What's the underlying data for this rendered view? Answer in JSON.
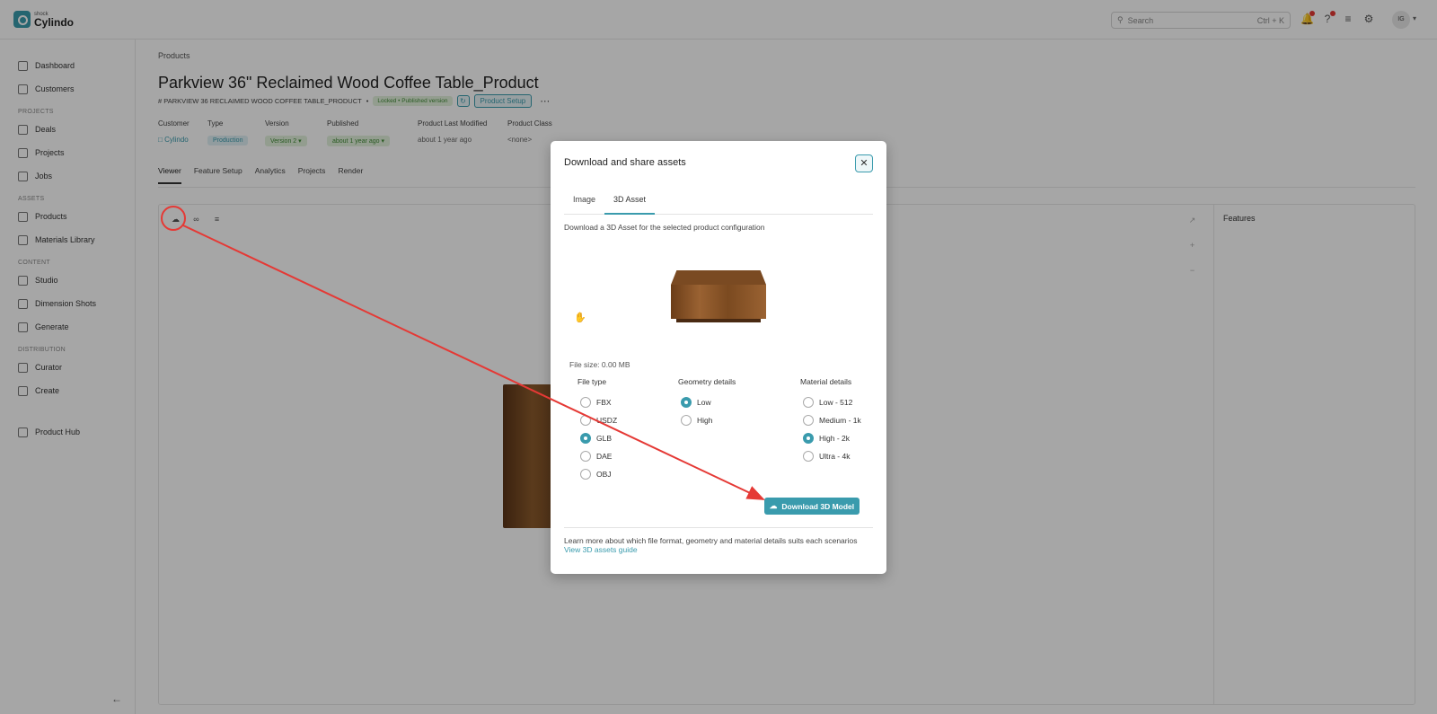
{
  "app": {
    "brand_small": "shock",
    "brand": "Cylindo"
  },
  "topbar": {
    "search_placeholder": "Search",
    "search_shortcut": "Ctrl + K",
    "avatar_initials": "IG",
    "icons": [
      "bell-icon",
      "help-icon",
      "sliders-icon",
      "bug-icon"
    ]
  },
  "sidebar": {
    "items": [
      {
        "label": "Dashboard",
        "icon": "home-icon"
      },
      {
        "label": "Customers",
        "icon": "customers-icon"
      },
      {
        "section": "PROJECTS"
      },
      {
        "label": "Deals",
        "icon": "deals-icon"
      },
      {
        "label": "Projects",
        "icon": "projects-icon"
      },
      {
        "label": "Jobs",
        "icon": "jobs-icon"
      },
      {
        "section": "ASSETS"
      },
      {
        "label": "Products",
        "icon": "products-icon"
      },
      {
        "label": "Materials Library",
        "icon": "materials-icon"
      },
      {
        "section": "CONTENT"
      },
      {
        "label": "Studio",
        "icon": "camera-icon"
      },
      {
        "label": "Dimension Shots",
        "icon": "dimension-icon"
      },
      {
        "label": "Generate",
        "icon": "sparkle-icon"
      },
      {
        "section": "DISTRIBUTION"
      },
      {
        "label": "Curator",
        "icon": "curator-icon"
      },
      {
        "label": "Create",
        "icon": "share-icon"
      },
      {
        "label": "Product Hub",
        "icon": "monitor-icon"
      }
    ]
  },
  "page": {
    "breadcrumb": "Products",
    "title": "Parkview 36\" Reclaimed Wood Coffee Table_Product",
    "sku": "# PARKVIEW 36 RECLAIMED WOOD COFFEE TABLE_PRODUCT",
    "lock_status": "Locked • Published version",
    "setup_label": "Product Setup",
    "meta": {
      "customer_label": "Customer",
      "customer_value": "Cylindo",
      "type_label": "Type",
      "type_value": "Production",
      "version_label": "Version",
      "version_value": "Version 2",
      "published_label": "Published",
      "published_value": "about 1 year ago",
      "modified_label": "Product Last Modified",
      "modified_value": "about 1 year ago",
      "class_label": "Product Class",
      "class_value": "<none>"
    },
    "tabs": [
      "Viewer",
      "Feature Setup",
      "Analytics",
      "Projects",
      "Render"
    ],
    "features_title": "Features"
  },
  "modal": {
    "title": "Download and share assets",
    "tabs": [
      "Image",
      "3D Asset"
    ],
    "active_tab": "3D Asset",
    "description": "Download a 3D Asset for the selected product configuration",
    "file_size": "File size: 0.00 MB",
    "file_type": {
      "title": "File type",
      "options": [
        "FBX",
        "USDZ",
        "GLB",
        "DAE",
        "OBJ"
      ],
      "selected": "GLB"
    },
    "geometry": {
      "title": "Geometry details",
      "options": [
        "Low",
        "High"
      ],
      "selected": "Low"
    },
    "material": {
      "title": "Material details",
      "options": [
        "Low - 512",
        "Medium - 1k",
        "High - 2k",
        "Ultra - 4k"
      ],
      "selected": "High - 2k"
    },
    "download_label": "Download 3D Model",
    "learn_more": "Learn more about which file format, geometry and material details suits each scenarios",
    "guide_link": "View 3D assets guide"
  },
  "colors": {
    "accent": "#3a9bad",
    "annotation": "#e53935"
  }
}
